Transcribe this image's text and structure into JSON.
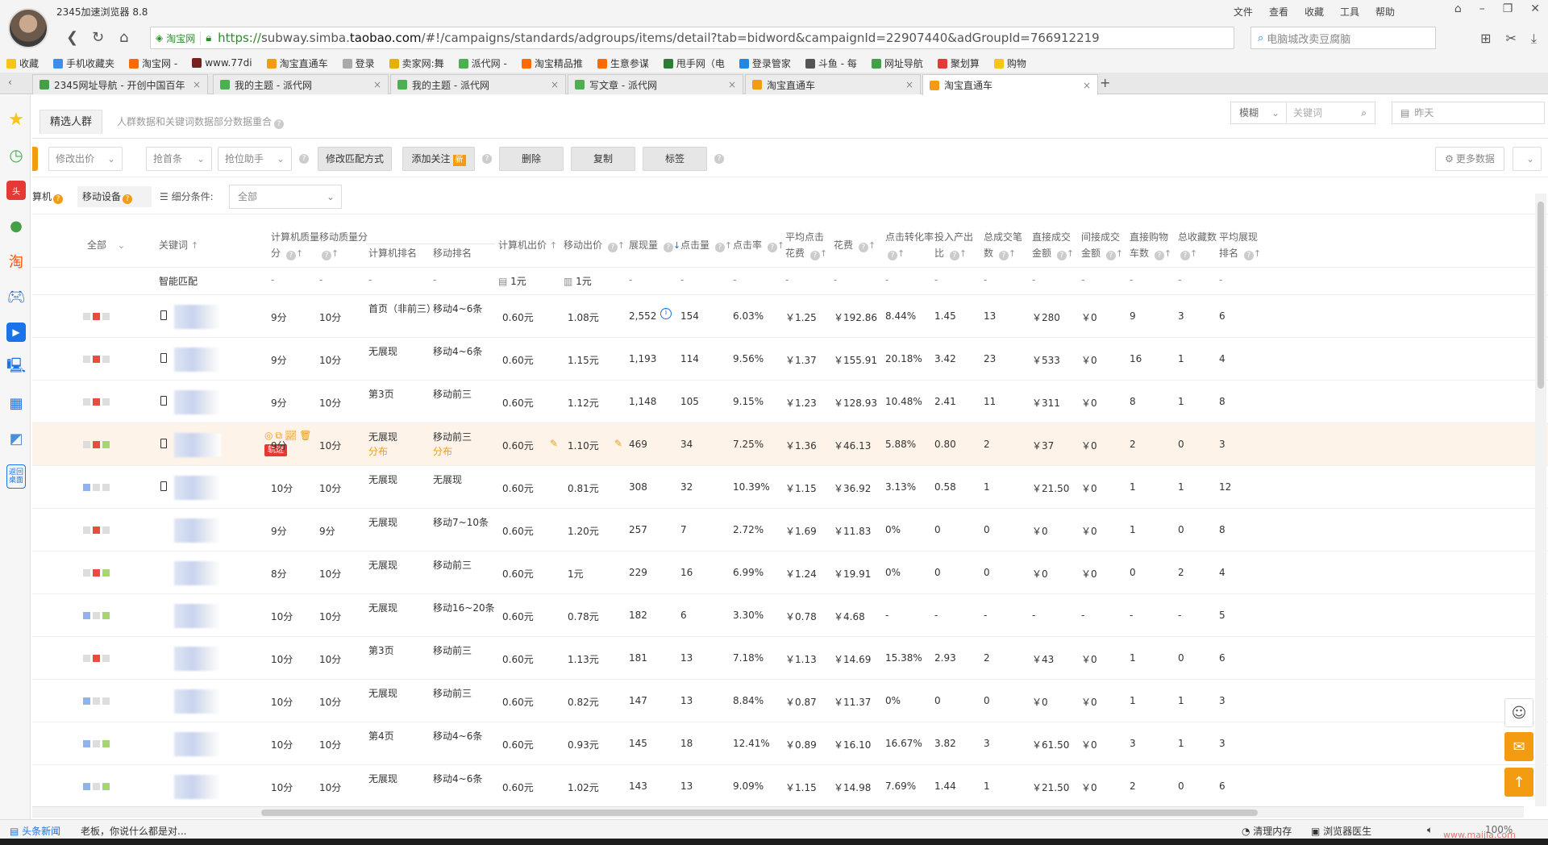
{
  "window": {
    "title": "2345加速浏览器 8.8",
    "menu": [
      "文件",
      "查看",
      "收藏",
      "工具",
      "帮助"
    ]
  },
  "address": {
    "site_badge": "淘宝网",
    "url_scheme": "https://",
    "url_host_pre": "subway.simba.",
    "url_host_domain": "taobao.com",
    "url_path": "/#!/campaigns/standards/adgroups/items/detail?tab=bidword&campaignId=22907440&adGroupId=766912219",
    "search_placeholder": "电脑城改卖豆腐脑"
  },
  "bookmarks": [
    {
      "label": "收藏",
      "color": "#f5c518"
    },
    {
      "label": "手机收藏夹",
      "color": "#3c8ee6"
    },
    {
      "label": "淘宝网 -",
      "color": "#ff6a00"
    },
    {
      "label": "www.77di",
      "color": "#7a1f1f"
    },
    {
      "label": "淘宝直通车",
      "color": "#f39c12"
    },
    {
      "label": "登录",
      "color": "#aaaaaa"
    },
    {
      "label": "卖家网:舞",
      "color": "#e4b100"
    },
    {
      "label": "派代网 -",
      "color": "#4caf50"
    },
    {
      "label": "淘宝精品推",
      "color": "#ff6a00"
    },
    {
      "label": "生意参谋",
      "color": "#ff6a00"
    },
    {
      "label": "甩手网（电",
      "color": "#2e7d32"
    },
    {
      "label": "登录管家",
      "color": "#1e88e5"
    },
    {
      "label": "斗鱼 - 每",
      "color": "#555555"
    },
    {
      "label": "网址导航",
      "color": "#43a047"
    },
    {
      "label": "聚划算",
      "color": "#e53935"
    },
    {
      "label": "购物",
      "color": "#f5c518"
    }
  ],
  "tabs": [
    {
      "label": "2345网址导航 - 开创中国百年",
      "color": "#43a047"
    },
    {
      "label": "我的主题 - 派代网",
      "color": "#4caf50"
    },
    {
      "label": "我的主题 - 派代网",
      "color": "#4caf50"
    },
    {
      "label": "写文章 - 派代网",
      "color": "#4caf50"
    },
    {
      "label": "淘宝直通车",
      "color": "#f39c12"
    },
    {
      "label": "淘宝直通车",
      "color": "#f39c12"
    }
  ],
  "subtabs": {
    "active": "精选人群",
    "desc": "人群数据和关键词数据部分数据重合",
    "mode": "模糊",
    "kw_placeholder": "关键词",
    "date": "昨天"
  },
  "toolbar": {
    "modify_bid": "修改出价",
    "grab_top": "抢首条",
    "grab_helper": "抢位助手",
    "modify_match": "修改匹配方式",
    "add_follow": "添加关注",
    "new_badge": "新",
    "delete": "删除",
    "copy": "复制",
    "tag": "标签",
    "more_data": "更多数据"
  },
  "filterrow": {
    "pc": "算机",
    "mobile": "移动设备",
    "segment_label": "细分条件:",
    "segment_value": "全部"
  },
  "table": {
    "headers": {
      "all": "全部",
      "keyword": "关键词",
      "pc_quality": "计算机质量分",
      "mob_quality": "移动质量分",
      "pc_rank": "计算机排名",
      "mob_rank": "移动排名",
      "pc_bid": "计算机出价",
      "mob_bid": "移动出价",
      "impressions": "展现量",
      "clicks": "点击量",
      "ctr": "点击率",
      "avg_cpc": "平均点击花费",
      "cost": "花费",
      "cvr": "点击转化率",
      "roi": "投入产出比",
      "total_deals": "总成交笔数",
      "direct_gmv": "直接成交金额",
      "indirect_gmv": "间接成交金额",
      "direct_cart": "直接购物车数",
      "total_fav": "总收藏数",
      "avg_rank": "平均展现排名"
    },
    "smart": {
      "keyword": "智能匹配",
      "pc_bid": "1元",
      "mob_bid": "1元",
      "dash": "-"
    },
    "rows": [
      {
        "s": [
          "#ddd",
          "#e74c3c",
          "#ddd"
        ],
        "pcq": "9分",
        "mq": "10分",
        "pr": "首页（非前三）",
        "prs": "",
        "mr": "移动4~6条",
        "mrs": "",
        "pb": "0.60元",
        "mb": "1.08元",
        "imp": "2,552",
        "clk": "154",
        "ctr": "6.03%",
        "cpc": "￥1.25",
        "cost": "￥192.86",
        "cvr": "8.44%",
        "roi": "1.45",
        "deals": "13",
        "dg": "￥280",
        "ig": "￥0",
        "cart": "9",
        "fav": "3",
        "ar": "6"
      },
      {
        "s": [
          "#ddd",
          "#e74c3c",
          "#ddd"
        ],
        "pcq": "9分",
        "mq": "10分",
        "pr": "无展现",
        "prs": "",
        "mr": "移动4~6条",
        "mrs": "",
        "pb": "0.60元",
        "mb": "1.15元",
        "imp": "1,193",
        "clk": "114",
        "ctr": "9.56%",
        "cpc": "￥1.37",
        "cost": "￥155.91",
        "cvr": "20.18%",
        "roi": "3.42",
        "deals": "23",
        "dg": "￥533",
        "ig": "￥0",
        "cart": "16",
        "fav": "1",
        "ar": "4"
      },
      {
        "s": [
          "#ddd",
          "#e74c3c",
          "#ddd"
        ],
        "pcq": "9分",
        "mq": "10分",
        "pr": "第3页",
        "prs": "",
        "mr": "移动前三",
        "mrs": "",
        "pb": "0.60元",
        "mb": "1.12元",
        "imp": "1,148",
        "clk": "105",
        "ctr": "9.15%",
        "cpc": "￥1.23",
        "cost": "￥128.93",
        "cvr": "10.48%",
        "roi": "2.41",
        "deals": "11",
        "dg": "￥311",
        "ig": "￥0",
        "cart": "8",
        "fav": "1",
        "ar": "8"
      },
      {
        "s": [
          "#ddd",
          "#e74c3c",
          "#a5d66f"
        ],
        "pcq": "9分",
        "mq": "10分",
        "pr": "无展现",
        "prs": "分布",
        "mr": "移动前三",
        "mrs": "分布",
        "pb": "0.60元",
        "mb": "1.10元",
        "imp": "469",
        "clk": "34",
        "ctr": "7.25%",
        "cpc": "￥1.36",
        "cost": "￥46.13",
        "cvr": "5.88%",
        "roi": "0.80",
        "deals": "2",
        "dg": "￥37",
        "ig": "￥0",
        "cart": "2",
        "fav": "0",
        "ar": "3"
      },
      {
        "s": [
          "#8fb3ea",
          "#ddd",
          "#ddd"
        ],
        "pcq": "10分",
        "mq": "10分",
        "pr": "无展现",
        "prs": "",
        "mr": "无展现",
        "mrs": "",
        "pb": "0.60元",
        "mb": "0.81元",
        "imp": "308",
        "clk": "32",
        "ctr": "10.39%",
        "cpc": "￥1.15",
        "cost": "￥36.92",
        "cvr": "3.13%",
        "roi": "0.58",
        "deals": "1",
        "dg": "￥21.50",
        "ig": "￥0",
        "cart": "1",
        "fav": "1",
        "ar": "12"
      },
      {
        "s": [
          "#ddd",
          "#e74c3c",
          "#ddd"
        ],
        "pcq": "9分",
        "mq": "9分",
        "pr": "无展现",
        "prs": "",
        "mr": "移动7~10条",
        "mrs": "",
        "pb": "0.60元",
        "mb": "1.20元",
        "imp": "257",
        "clk": "7",
        "ctr": "2.72%",
        "cpc": "￥1.69",
        "cost": "￥11.83",
        "cvr": "0%",
        "roi": "0",
        "deals": "0",
        "dg": "￥0",
        "ig": "￥0",
        "cart": "1",
        "fav": "0",
        "ar": "8"
      },
      {
        "s": [
          "#ddd",
          "#e74c3c",
          "#a5d66f"
        ],
        "pcq": "8分",
        "mq": "10分",
        "pr": "无展现",
        "prs": "",
        "mr": "移动前三",
        "mrs": "",
        "pb": "0.60元",
        "mb": "1元",
        "imp": "229",
        "clk": "16",
        "ctr": "6.99%",
        "cpc": "￥1.24",
        "cost": "￥19.91",
        "cvr": "0%",
        "roi": "0",
        "deals": "0",
        "dg": "￥0",
        "ig": "￥0",
        "cart": "0",
        "fav": "2",
        "ar": "4"
      },
      {
        "s": [
          "#8fb3ea",
          "#ddd",
          "#a5d66f"
        ],
        "pcq": "10分",
        "mq": "10分",
        "pr": "无展现",
        "prs": "",
        "mr": "移动16~20条",
        "mrs": "",
        "pb": "0.60元",
        "mb": "0.78元",
        "imp": "182",
        "clk": "6",
        "ctr": "3.30%",
        "cpc": "￥0.78",
        "cost": "￥4.68",
        "cvr": "-",
        "roi": "-",
        "deals": "-",
        "dg": "-",
        "ig": "-",
        "cart": "-",
        "fav": "-",
        "ar": "5"
      },
      {
        "s": [
          "#ddd",
          "#e74c3c",
          "#ddd"
        ],
        "pcq": "10分",
        "mq": "10分",
        "pr": "第3页",
        "prs": "",
        "mr": "移动前三",
        "mrs": "",
        "pb": "0.60元",
        "mb": "1.13元",
        "imp": "181",
        "clk": "13",
        "ctr": "7.18%",
        "cpc": "￥1.13",
        "cost": "￥14.69",
        "cvr": "15.38%",
        "roi": "2.93",
        "deals": "2",
        "dg": "￥43",
        "ig": "￥0",
        "cart": "1",
        "fav": "0",
        "ar": "6"
      },
      {
        "s": [
          "#8fb3ea",
          "#ddd",
          "#ddd"
        ],
        "pcq": "10分",
        "mq": "10分",
        "pr": "无展现",
        "prs": "",
        "mr": "移动前三",
        "mrs": "",
        "pb": "0.60元",
        "mb": "0.82元",
        "imp": "147",
        "clk": "13",
        "ctr": "8.84%",
        "cpc": "￥0.87",
        "cost": "￥11.37",
        "cvr": "0%",
        "roi": "0",
        "deals": "0",
        "dg": "￥0",
        "ig": "￥0",
        "cart": "1",
        "fav": "1",
        "ar": "3"
      },
      {
        "s": [
          "#8fb3ea",
          "#ddd",
          "#a5d66f"
        ],
        "pcq": "10分",
        "mq": "10分",
        "pr": "第4页",
        "prs": "",
        "mr": "移动4~6条",
        "mrs": "",
        "pb": "0.60元",
        "mb": "0.93元",
        "imp": "145",
        "clk": "18",
        "ctr": "12.41%",
        "cpc": "￥0.89",
        "cost": "￥16.10",
        "cvr": "16.67%",
        "roi": "3.82",
        "deals": "3",
        "dg": "￥61.50",
        "ig": "￥0",
        "cart": "3",
        "fav": "1",
        "ar": "3"
      },
      {
        "s": [
          "#8fb3ea",
          "#ddd",
          "#a5d66f"
        ],
        "pcq": "10分",
        "mq": "10分",
        "pr": "无展现",
        "prs": "",
        "mr": "移动4~6条",
        "mrs": "",
        "pb": "0.60元",
        "mb": "1.02元",
        "imp": "143",
        "clk": "13",
        "ctr": "9.09%",
        "cpc": "￥1.15",
        "cost": "￥14.98",
        "cvr": "7.69%",
        "roi": "1.44",
        "deals": "1",
        "dg": "￥21.50",
        "ig": "￥0",
        "cart": "2",
        "fav": "0",
        "ar": "6"
      }
    ],
    "highlight_tag": "轨迹"
  },
  "statusbar": {
    "news": "头条新闻",
    "ticker": "老板，你说什么都是对...",
    "clean_mem": "清理内存",
    "doctor": "浏览器医生",
    "zoom": "100%",
    "watermark": "www.maijia.com"
  }
}
